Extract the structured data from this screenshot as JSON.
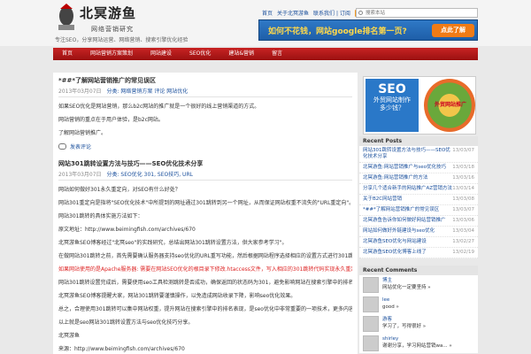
{
  "header": {
    "site_title": "北冥游鱼",
    "site_subtitle": "网络营销研究",
    "tagline": "专注SEO，分享网站运营、网络营销、搜索引擎优化经验",
    "toplinks": [
      "首页",
      "关于北冥游鱼",
      "联系我们 | 订阅"
    ],
    "search_placeholder": "搜索本站",
    "banner_text": "如何不花钱，网站google排名第一页?",
    "banner_button": "点此了解"
  },
  "nav": [
    "首页",
    "网站营销方案策划",
    "网站建设",
    "SEO优化",
    "建站&营销",
    "留言"
  ],
  "posts": [
    {
      "title": "*##*了解网站营销推广的常见误区",
      "meta": [
        "2013年03月07日",
        "分类: 网络营销方案",
        "评论",
        "网站优化"
      ],
      "paragraphs": [
        "如果SEO优化是网站营销，那么b2c网站的推广就是一个很好的线上营销渠道的方式。",
        "网站营销的重点在于用户体验，是b2c网站。",
        "了解网站营销推广。"
      ],
      "comment_label": "发表评论"
    },
    {
      "title": "网站301跳转设置方法与技巧——SEO优化技术分享",
      "meta": [
        "2013年03月07日",
        "分类: SEO优化",
        "301, SEO技巧, URL"
      ],
      "paragraphs": [
        "网站如何做好301永久重定向，对SEO有什么好处？",
        "网站301重定向是指将\"SEO优化技术\"中所提到的网址通过301跳转到另一个网址，从而保证网站权重不流失的\"URL重定向\"。",
        "网站301跳转的具体实施方法如下：",
        "原文地址：http://www.beimingfish.com/archives/670",
        "北冥游鱼SEO博客经过\"北冥seo\"的实践研究，总结出网站301跳转设置方法，供大家参考学习\"。",
        "在做网站301跳转之前，首先需要确认服务器支持seo优化的URL重写功能，然后根据网站程序选择相应的设置方式进行301跳转设置。",
        "如果网站使用的是Apache服务器: 需要在网站SEO优化的根目录下修改.htaccess文件，写入相应的301跳转代码实现永久重定向，IIS服务器则需要在服务器管理中设置。",
        "网站301跳转设置完成后，需要使用seo工具检测跳转是否成功，确保返回的状态码为301，避免影响网站在搜索引擎中的排名。",
        "北冥游鱼SEO博客提醒大家，网站301跳转要谨慎操作，以免造成网站收录下降，影响seo优化效果。",
        "总之，合理使用301跳转可以集中网站权重，提升网站在搜索引擎中的排名表现，是seo优化中非常重要的一项技术，更多内容请关注\"SEO优化技术\" 北冥游鱼博客。",
        "以上就是seo网站301跳转设置方法与seo优化技巧分享。",
        "北冥游鱼",
        "来源：http://www.beimingfish.com/archives/670"
      ]
    }
  ],
  "sidebar": {
    "ad_seo": "SEO",
    "ad_line1": "外贸网站制作",
    "ad_line2": "多少钱？",
    "ad_circle": "外贸网站推广",
    "recent_posts_title": "Recent Posts",
    "recent_posts": [
      {
        "title": "网站301跳转设置方法与技巧——SEO优化技术分享",
        "date": "13/03/07"
      },
      {
        "title": "北冥游鱼:网站营销推广与seo优化技巧",
        "date": "13/03/18"
      },
      {
        "title": "北冥游鱼:网站营销推广的方法",
        "date": "13/03/16"
      },
      {
        "title": "分享几个适合新手的网站推广AZ营销方法",
        "date": "13/03/14"
      },
      {
        "title": "关于B2C网站营销",
        "date": "13/03/08"
      },
      {
        "title": "*##*了解网站营销推广的常见误区",
        "date": "13/03/07"
      },
      {
        "title": "北冥游鱼告诉你如何做好网站营销推广",
        "date": "13/03/06"
      },
      {
        "title": "网站如何做好外链建设与seo优化",
        "date": "13/03/04"
      },
      {
        "title": "北冥游鱼SEO优化与网站建设",
        "date": "13/02/27"
      },
      {
        "title": "北冥游鱼SEO优化博客上线了",
        "date": "13/02/19"
      }
    ],
    "recent_comments_title": "Recent Comments",
    "recent_comments": [
      {
        "author": "博主",
        "text": "网站优化一定要坚持 »"
      },
      {
        "author": "lee",
        "text": "good »"
      },
      {
        "author": "游客",
        "text": "学习了，写得很好 »"
      },
      {
        "author": "shirley",
        "text": "谢谢分享，学习网站营销wa... »"
      }
    ]
  }
}
